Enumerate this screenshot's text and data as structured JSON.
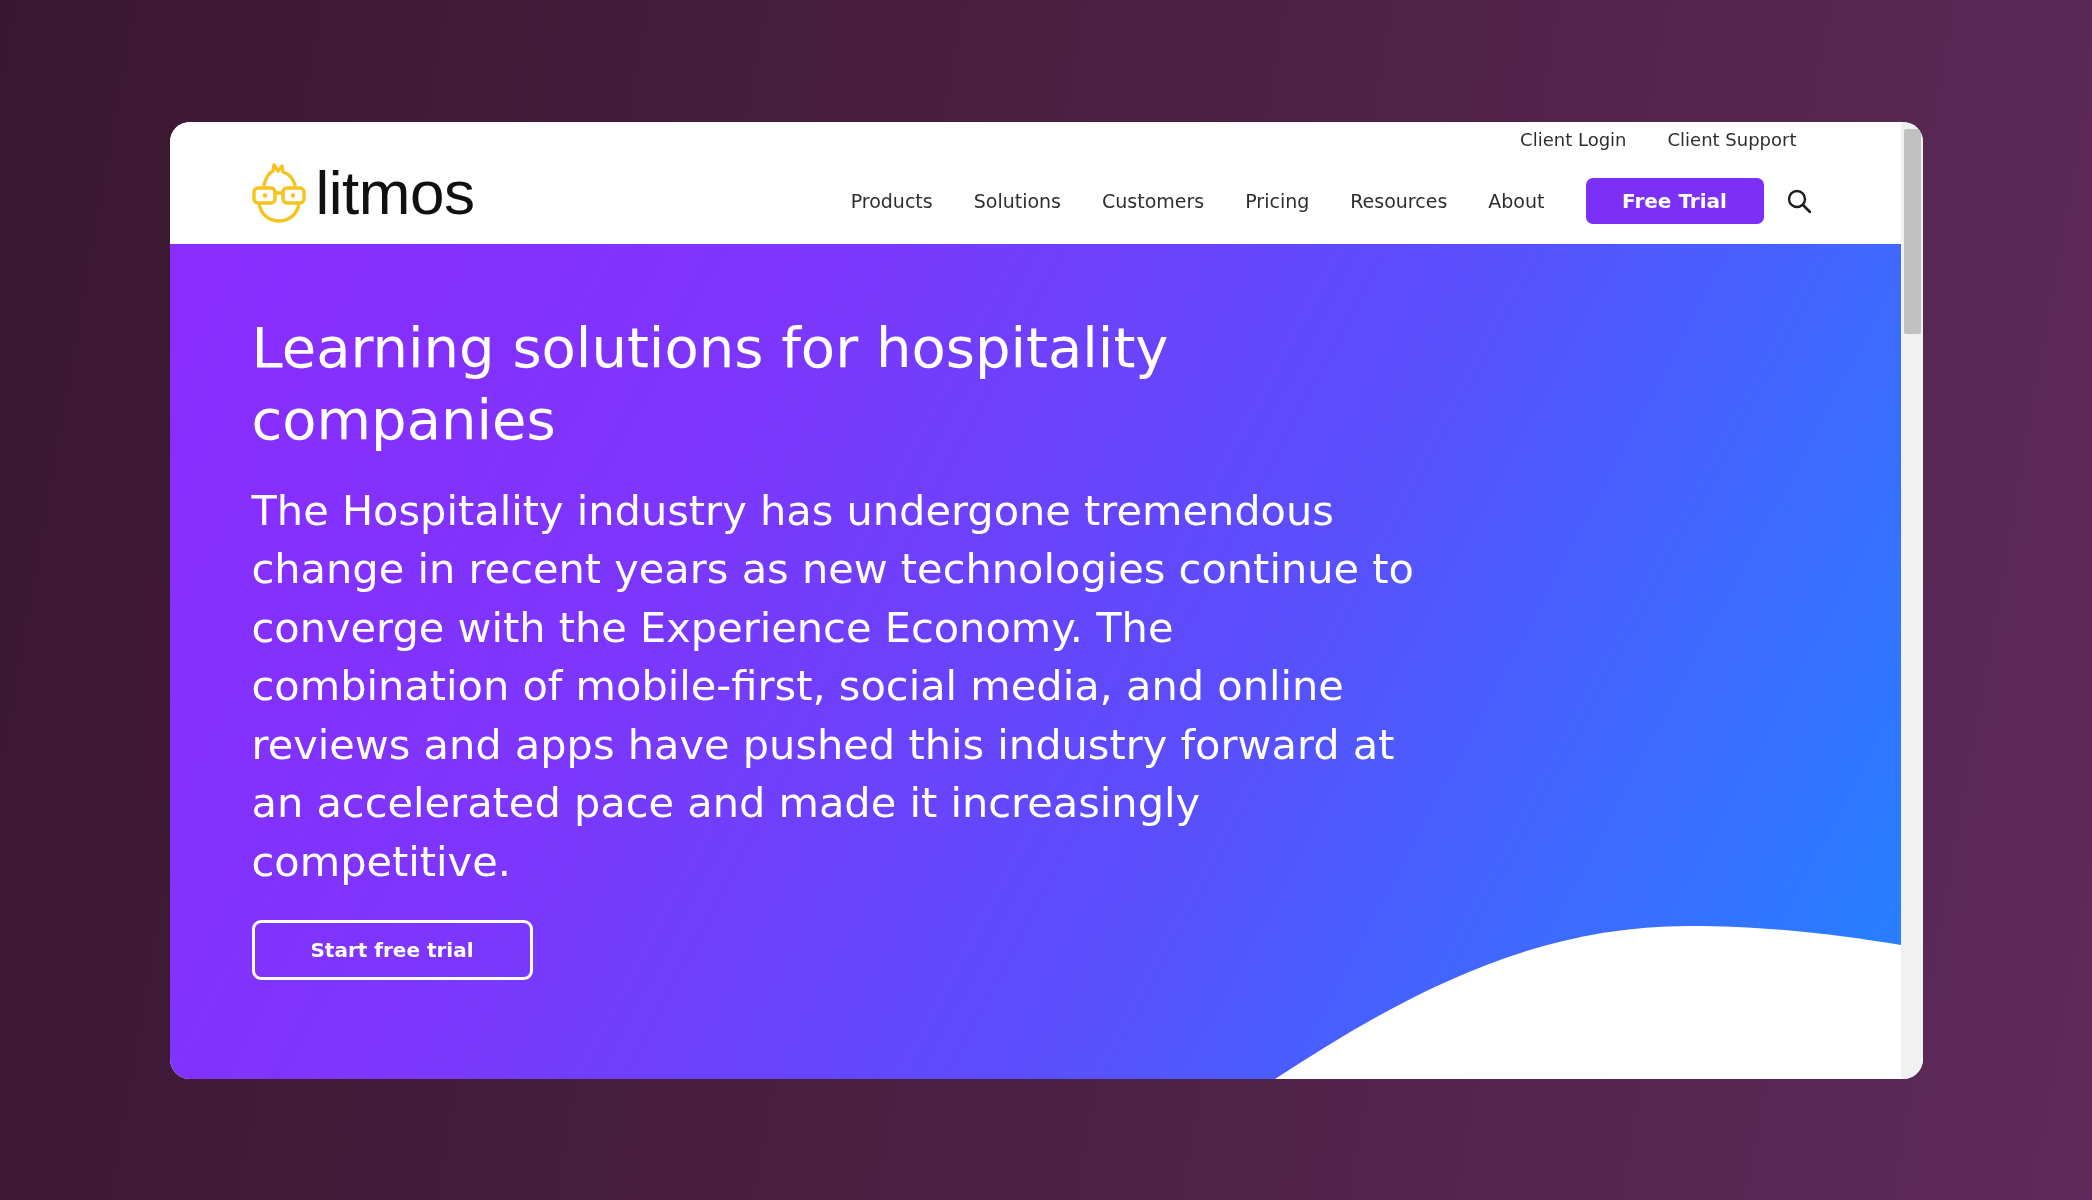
{
  "header": {
    "logo": {
      "text": "litmos"
    },
    "top_links": [
      "Client Login",
      "Client Support"
    ],
    "nav": [
      "Products",
      "Solutions",
      "Customers",
      "Pricing",
      "Resources",
      "About"
    ],
    "cta": "Free Trial"
  },
  "hero": {
    "title": "Learning solutions for hospitality companies",
    "body": "The Hospitality industry has undergone tremendous change in recent years as new technologies continue to converge with the Experience Economy. The combination of mobile-first, social media, and online reviews and apps have pushed this industry forward at an accelerated pace and made it increasingly competitive.",
    "button": "Start free trial"
  }
}
